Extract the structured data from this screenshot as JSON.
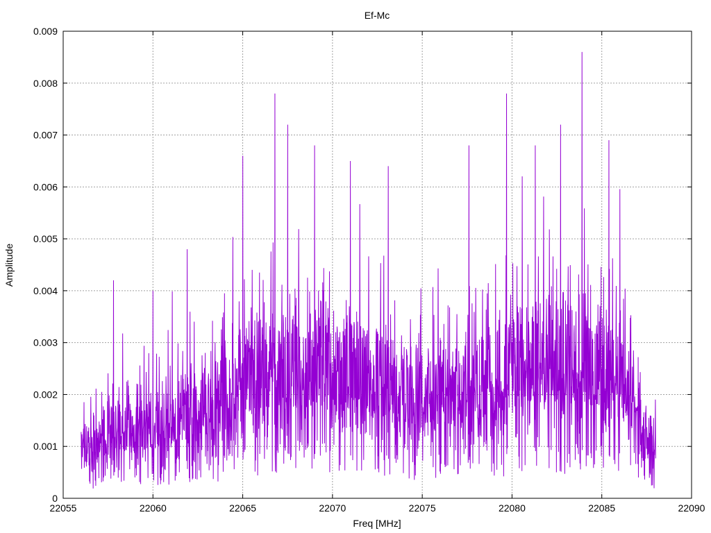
{
  "chart_data": {
    "type": "line",
    "title": "Ef-Mc",
    "xlabel": "Freq [MHz]",
    "ylabel": "Amplitude",
    "xlim": [
      22055,
      22090
    ],
    "ylim": [
      0,
      0.009
    ],
    "xticks": [
      22055,
      22060,
      22065,
      22070,
      22075,
      22080,
      22085,
      22090
    ],
    "xtick_labels": [
      "22055",
      "22060",
      "22065",
      "22070",
      "22075",
      "22080",
      "22085",
      "22090"
    ],
    "yticks": [
      0,
      0.001,
      0.002,
      0.003,
      0.004,
      0.005,
      0.006,
      0.007,
      0.008,
      0.009
    ],
    "ytick_labels": [
      "0",
      "0.001",
      "0.002",
      "0.003",
      "0.004",
      "0.005",
      "0.006",
      "0.007",
      "0.008",
      "0.009"
    ],
    "grid": true,
    "series": [
      {
        "color": "#9400d3",
        "x_range": [
          22056,
          22088
        ],
        "peaks": [
          {
            "x": 22057.8,
            "y": 0.0042
          },
          {
            "x": 22060.0,
            "y": 0.004
          },
          {
            "x": 22061.9,
            "y": 0.0048
          },
          {
            "x": 22065.0,
            "y": 0.0066
          },
          {
            "x": 22066.8,
            "y": 0.0078
          },
          {
            "x": 22067.5,
            "y": 0.0072
          },
          {
            "x": 22069.0,
            "y": 0.0068
          },
          {
            "x": 22071.0,
            "y": 0.0065
          },
          {
            "x": 22073.1,
            "y": 0.0064
          },
          {
            "x": 22077.6,
            "y": 0.0068
          },
          {
            "x": 22079.7,
            "y": 0.0078
          },
          {
            "x": 22081.3,
            "y": 0.0068
          },
          {
            "x": 22082.7,
            "y": 0.0072
          },
          {
            "x": 22083.9,
            "y": 0.0086
          },
          {
            "x": 22085.4,
            "y": 0.0069
          }
        ],
        "envelope": [
          {
            "x": 22056,
            "y": 0.0011
          },
          {
            "x": 22058,
            "y": 0.0015
          },
          {
            "x": 22060,
            "y": 0.0016
          },
          {
            "x": 22062,
            "y": 0.0019
          },
          {
            "x": 22064,
            "y": 0.0022
          },
          {
            "x": 22066,
            "y": 0.0028
          },
          {
            "x": 22068,
            "y": 0.0029
          },
          {
            "x": 22070,
            "y": 0.0028
          },
          {
            "x": 22072,
            "y": 0.0027
          },
          {
            "x": 22074,
            "y": 0.0024
          },
          {
            "x": 22076,
            "y": 0.0023
          },
          {
            "x": 22078,
            "y": 0.0025
          },
          {
            "x": 22080,
            "y": 0.0029
          },
          {
            "x": 22082,
            "y": 0.0031
          },
          {
            "x": 22084,
            "y": 0.0031
          },
          {
            "x": 22086,
            "y": 0.0026
          },
          {
            "x": 22088,
            "y": 0.0012
          }
        ]
      }
    ]
  }
}
